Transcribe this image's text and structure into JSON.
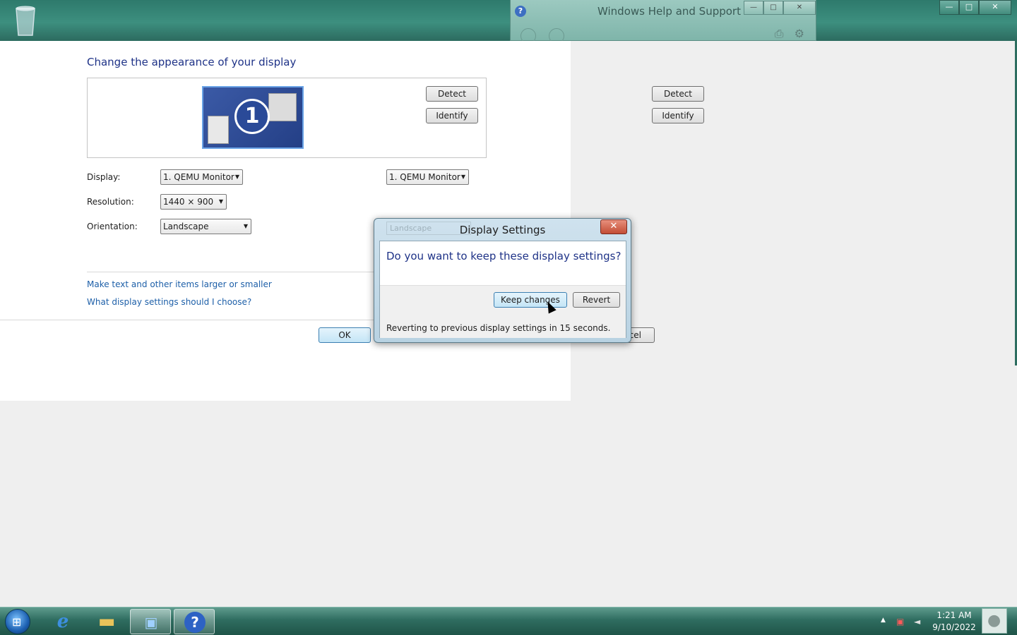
{
  "desktop": {
    "recycle_bin": "recycle-bin-icon"
  },
  "help_window": {
    "title": "Windows Help and Support",
    "minimize": "—",
    "maximize": "□",
    "close": "✕"
  },
  "bg_window_controls": {
    "minimize": "—",
    "maximize": "□",
    "close": "✕"
  },
  "display_panel": {
    "title": "Change the appearance of your display",
    "monitor_number": "1",
    "detect_label": "Detect",
    "identify_label": "Identify",
    "display_label": "Display:",
    "display_value": "1. QEMU Monitor",
    "resolution_label": "Resolution:",
    "resolution_value": "1440 × 900",
    "orientation_label": "Orientation:",
    "orientation_value": "Landscape",
    "link_text_size": "Make text and other items larger or smaller",
    "link_which_settings": "What display settings should I choose?",
    "ok_label": "OK"
  },
  "ghost_panel": {
    "detect_label": "Detect",
    "identify_label": "Identify",
    "display_value": "1. QEMU Monitor",
    "orientation_value": "Landscape",
    "cancel_partial": "cel"
  },
  "dialog": {
    "title": "Display Settings",
    "close": "✕",
    "question": "Do you want to keep these display settings?",
    "keep_label": "Keep changes",
    "revert_label": "Revert",
    "countdown": "Reverting to previous display settings in 15 seconds."
  },
  "taskbar": {
    "ie_glyph": "e",
    "help_glyph": "?",
    "tray_arrow": "▲",
    "time": "1:21 AM",
    "date": "9/10/2022"
  }
}
